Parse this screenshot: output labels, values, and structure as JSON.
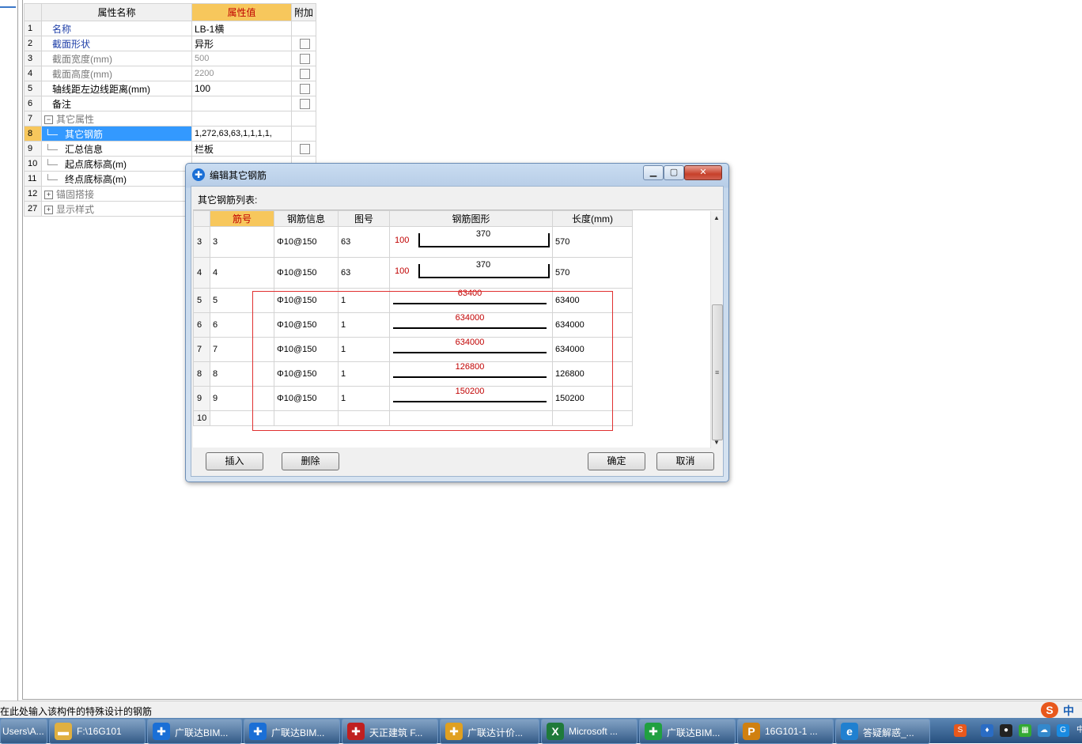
{
  "prop_grid": {
    "headers": {
      "num": "",
      "name": "属性名称",
      "value": "属性值",
      "extra": "附加"
    },
    "rows": [
      {
        "num": "1",
        "name": "名称",
        "value": "LB-1横",
        "check": false,
        "style": "blue"
      },
      {
        "num": "2",
        "name": "截面形状",
        "value": "异形",
        "check": true,
        "style": "blue"
      },
      {
        "num": "3",
        "name": "截面宽度(mm)",
        "value": "500",
        "check": true,
        "style": "gray"
      },
      {
        "num": "4",
        "name": "截面高度(mm)",
        "value": "2200",
        "check": true,
        "style": "gray"
      },
      {
        "num": "5",
        "name": "轴线距左边线距离(mm)",
        "value": "100",
        "check": true,
        "style": "normal"
      },
      {
        "num": "6",
        "name": "备注",
        "value": "",
        "check": true,
        "style": "normal"
      },
      {
        "num": "7",
        "name": "其它属性",
        "value": "",
        "check": false,
        "style": "group",
        "tree": "−"
      },
      {
        "num": "8",
        "name": "其它钢筋",
        "value": "1,272,63,63,1,1,1,1,",
        "check": false,
        "style": "selected"
      },
      {
        "num": "9",
        "name": "汇总信息",
        "value": "栏板",
        "check": true,
        "style": "child"
      },
      {
        "num": "10",
        "name": "起点底标高(m)",
        "value": "",
        "check": false,
        "style": "child"
      },
      {
        "num": "11",
        "name": "终点底标高(m)",
        "value": "",
        "check": false,
        "style": "child"
      },
      {
        "num": "12",
        "name": "锚固搭接",
        "value": "",
        "check": false,
        "style": "group",
        "tree": "+"
      },
      {
        "num": "27",
        "name": "显示样式",
        "value": "",
        "check": false,
        "style": "group",
        "tree": "+"
      }
    ]
  },
  "dialog": {
    "title": "编辑其它钢筋",
    "list_label": "其它钢筋列表:",
    "columns": [
      "",
      "筋号",
      "钢筋信息",
      "图号",
      "钢筋图形",
      "长度(mm)"
    ],
    "rows": [
      {
        "num": "3",
        "bar": "3",
        "info": "Φ10@150",
        "fig": "63",
        "shape_type": "hook",
        "shape_left": "100",
        "shape_mid": "370",
        "length": "570"
      },
      {
        "num": "4",
        "bar": "4",
        "info": "Φ10@150",
        "fig": "63",
        "shape_type": "hook",
        "shape_left": "100",
        "shape_mid": "370",
        "length": "570"
      },
      {
        "num": "5",
        "bar": "5",
        "info": "Φ10@150",
        "fig": "1",
        "shape_type": "line",
        "shape_left": "",
        "shape_mid": "63400",
        "length": "63400"
      },
      {
        "num": "6",
        "bar": "6",
        "info": "Φ10@150",
        "fig": "1",
        "shape_type": "line",
        "shape_left": "",
        "shape_mid": "634000",
        "length": "634000"
      },
      {
        "num": "7",
        "bar": "7",
        "info": "Φ10@150",
        "fig": "1",
        "shape_type": "line",
        "shape_left": "",
        "shape_mid": "634000",
        "length": "634000"
      },
      {
        "num": "8",
        "bar": "8",
        "info": "Φ10@150",
        "fig": "1",
        "shape_type": "line",
        "shape_left": "",
        "shape_mid": "126800",
        "length": "126800"
      },
      {
        "num": "9",
        "bar": "9",
        "info": "Φ10@150",
        "fig": "1",
        "shape_type": "line",
        "shape_left": "",
        "shape_mid": "150200",
        "length": "150200"
      },
      {
        "num": "10",
        "bar": "",
        "info": "",
        "fig": "",
        "shape_type": "none",
        "shape_left": "",
        "shape_mid": "",
        "length": ""
      }
    ],
    "buttons": {
      "insert": "插入",
      "delete": "删除",
      "ok": "确定",
      "cancel": "取消"
    }
  },
  "statusbar": {
    "text": "在此处输入该构件的特殊设计的钢筋",
    "ime": "中"
  },
  "taskbar": {
    "items": [
      {
        "label": "Users\\A...",
        "icon": "",
        "color": "#3a6ea5"
      },
      {
        "label": "F:\\16G101",
        "icon": "folder-icon",
        "color": "#e0b040"
      },
      {
        "label": "广联达BIM...",
        "icon": "glodon-icon",
        "color": "#1a6fd6"
      },
      {
        "label": "广联达BIM...",
        "icon": "glodon-icon",
        "color": "#1a6fd6"
      },
      {
        "label": "天正建筑 F...",
        "icon": "tangent-icon",
        "color": "#c02020"
      },
      {
        "label": "广联达计价...",
        "icon": "pricing-icon",
        "color": "#e0a020"
      },
      {
        "label": "Microsoft ...",
        "icon": "excel-icon",
        "color": "#1f7a3a"
      },
      {
        "label": "广联达BIM...",
        "icon": "glodon-green-icon",
        "color": "#20a040"
      },
      {
        "label": "16G101-1 ...",
        "icon": "pdf-icon",
        "color": "#d08010"
      },
      {
        "label": "答疑解惑_...",
        "icon": "ie-icon",
        "color": "#2080d0"
      }
    ]
  }
}
